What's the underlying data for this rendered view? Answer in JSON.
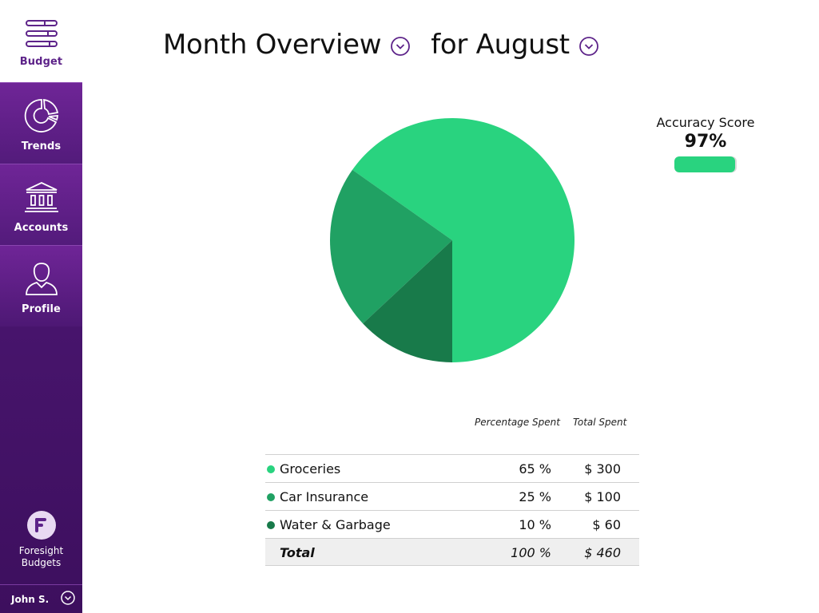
{
  "sidebar": {
    "items": [
      {
        "label": "Budget",
        "icon": "sliders-icon",
        "active": true
      },
      {
        "label": "Trends",
        "icon": "donut-chart-icon"
      },
      {
        "label": "Accounts",
        "icon": "bank-icon"
      },
      {
        "label": "Profile",
        "icon": "user-icon"
      }
    ],
    "brand": {
      "name": "Foresight Budgets",
      "logo": "foresight-logo-icon"
    },
    "user": {
      "name": "John S."
    }
  },
  "header": {
    "view": "Month Overview",
    "period": "for August"
  },
  "accuracy": {
    "label": "Accuracy Score",
    "value": "97%",
    "fraction": 0.97
  },
  "colors": {
    "accent": "#5d2389",
    "light_green": "#29d37f",
    "mid_green": "#20a163",
    "dark_green": "#187a4a"
  },
  "table": {
    "col_pct": "Percentage Spent",
    "col_total": "Total Spent",
    "rows": [
      {
        "name": "Groceries",
        "pct": "65 %",
        "amount": "$ 300",
        "color": "#29d37f"
      },
      {
        "name": "Car Insurance",
        "pct": "25 %",
        "amount": "$ 100",
        "color": "#20a163"
      },
      {
        "name": "Water & Garbage",
        "pct": "10 %",
        "amount": "$ 60",
        "color": "#187a4a"
      }
    ],
    "total": {
      "name": "Total",
      "pct": "100 %",
      "amount": "$ 460"
    }
  },
  "chart_data": {
    "type": "pie",
    "categories": [
      "Groceries",
      "Car Insurance",
      "Water & Garbage"
    ],
    "values": [
      300,
      100,
      60
    ],
    "colors": [
      "#29d37f",
      "#20a163",
      "#187a4a"
    ]
  }
}
